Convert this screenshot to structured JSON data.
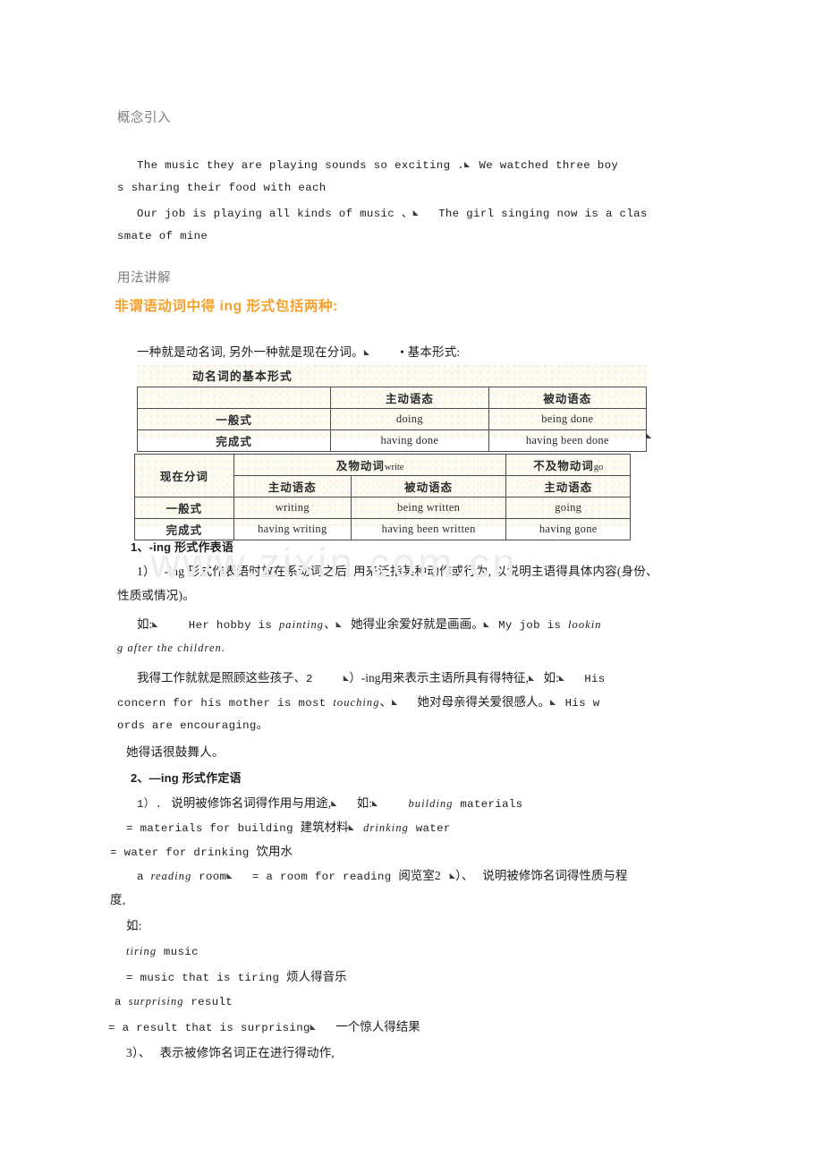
{
  "document": {
    "watermark": "www.zixin.com.cn",
    "accent_color": "#f5a02a",
    "heading_color": "#7c7c7c",
    "page_background": "#ffffff",
    "table_background": "#fdfcf3"
  },
  "sections": {
    "concept_heading": "概念引入",
    "usage_heading": "用法讲解",
    "orange_heading": "非谓语动词中得 ing 形式包括两种:"
  },
  "concept_examples": {
    "line1": "The music  they  are playing sounds  so exciting .",
    "line1_cont": "We  watched three  boy",
    "line2": "s sharing  their  food  with each",
    "line3": "Our job is playing  all  kinds of music 、",
    "line3_cont": "The girl   singing now is a clas",
    "line4": "smate of mine"
  },
  "forms_intro": {
    "text": "一种就是动名词, 另外一种就是现在分词。",
    "bullet": "•",
    "bullet_text": "基本形式:"
  },
  "table_gerund": {
    "title": "动名词的基本形式",
    "columns": [
      "",
      "主动语态",
      "被动语态"
    ],
    "rows": [
      {
        "label": "一般式",
        "active": "doing",
        "passive": "being done"
      },
      {
        "label": "完成式",
        "active": "having done",
        "passive": "having been done"
      }
    ]
  },
  "table_participle": {
    "corner": "现在分词",
    "group_transitive_cn": "及物动词",
    "group_transitive_en": "write",
    "group_intransitive_cn": "不及物动词",
    "group_intransitive_en": "go",
    "subheaders": [
      "主动语态",
      "被动语态",
      "主动语态"
    ],
    "rows": [
      {
        "label": "一般式",
        "trans_active": "writing",
        "trans_passive": "being written",
        "intrans_active": "going"
      },
      {
        "label": "完成式",
        "trans_active": "having writing",
        "trans_passive": "having been written",
        "intrans_active": "having gone"
      }
    ]
  },
  "section1": {
    "heading": "1、-ing 形式作表语",
    "p1_num": "1）",
    "p1_a": "-ing 形式作表语时放在系动词之后, 用来泛指某种动作或行为, 以说明主语得具体内容(身份、",
    "p1_b": "性质或情况)。",
    "ex_label": "如:",
    "ex1_en1": "Her hobby  is ",
    "ex1_it1": "painting",
    "ex1_sep": "、",
    "ex1_cn": "她得业余爱好就是画画。",
    "ex1_en2": "My job is ",
    "ex1_it2": "lookin",
    "ex1_it2b": "g after the children.",
    "p2_cn": "我得工作就就是照顾这些孩子、",
    "p2_num": "2",
    "p2_a": "）-ing用来表示主语所具有得特征,",
    "p2_ex_label": "如:",
    "ex2_en1": "His",
    "ex2_en2": "concern for his mother is  most ",
    "ex2_it": "touching",
    "ex2_sep": "、",
    "ex2_cn": "她对母亲得关爱很感人。",
    "ex2_en3": "His w",
    "ex2_en4": "ords  are encouraging。",
    "p3_cn": "她得话很鼓舞人。"
  },
  "section2": {
    "heading": "2、—ing 形式作定语",
    "p1_num": "1）.",
    "p1_cn": "说明被修饰名词得作用与用途,",
    "p1_ex_label": "如:",
    "ex1_it": "building",
    "ex1_en": " materials",
    "ex1_eq": "= materials for building ",
    "ex1_cn": "建筑材料",
    "ex2_it": "drinking",
    "ex2_en": " water",
    "ex2_eq": "= water for drinking  ",
    "ex2_cn": "饮用水",
    "ex3_a": "a ",
    "ex3_it": "reading",
    "ex3_b": "  room",
    "ex3_eq": "= a room for reading   ",
    "ex3_cn": "阅览室2",
    "p2_num": "）、",
    "p2_cn": "说明被修饰名词得性质与程",
    "p2_cn_b": "度,",
    "p2_ex_label": "如:",
    "ex4_it": "tiring",
    "ex4_en": " music",
    "ex4_eq": "= music that is tiring  ",
    "ex4_cn": "烦人得音乐",
    "ex5_a": "a ",
    "ex5_it": "surprising",
    "ex5_b": " result",
    "ex5_eq": "= a result that is surprising",
    "ex5_cn": "一个惊人得结果",
    "p3_num": "3）、",
    "p3_cn": "表示被修饰名词正在进行得动作,"
  },
  "symbols": {
    "soft_return": "◣",
    "bullet": "•"
  }
}
